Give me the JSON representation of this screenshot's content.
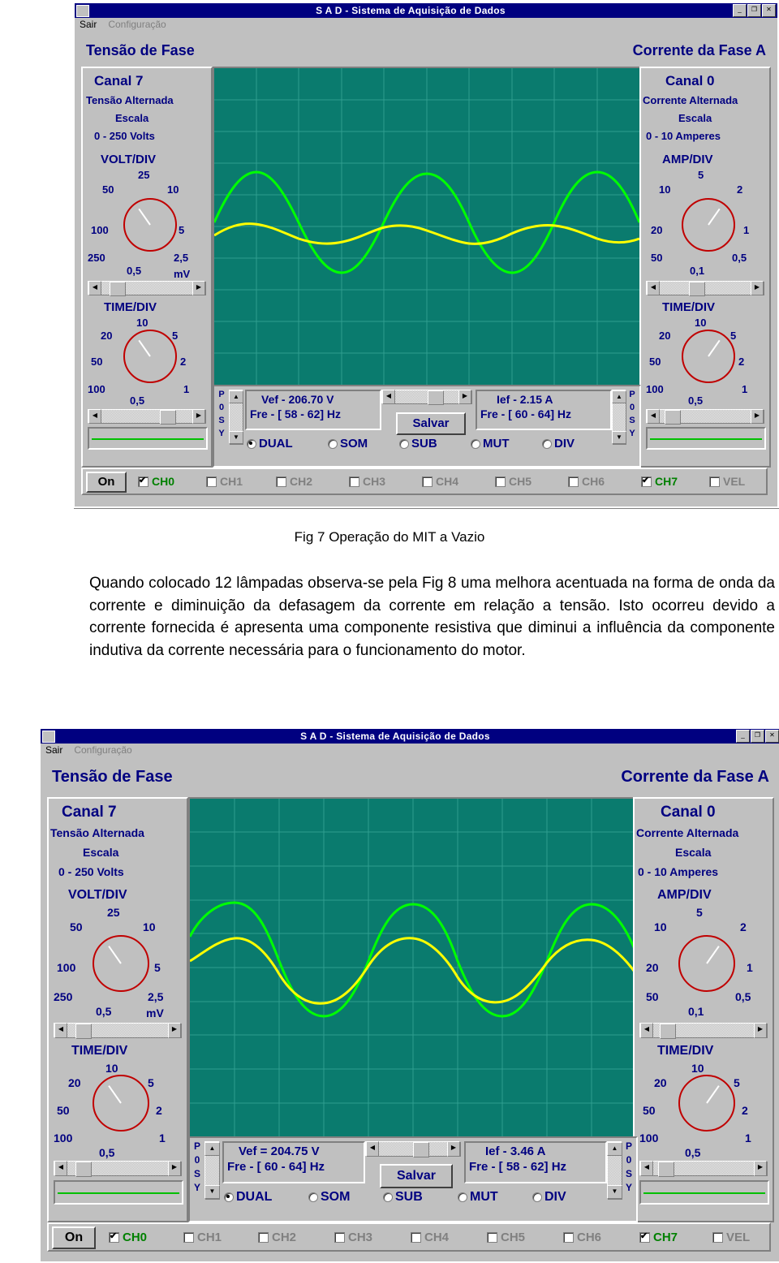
{
  "figure1": {
    "window": {
      "title": "S A D - Sistema de Aquisição de Dados",
      "minimize": "_",
      "maximize": "❐",
      "close": "✕",
      "menu": [
        "Sair",
        "Configuração"
      ]
    },
    "header_left": "Tensão de Fase",
    "header_right": "Corrente da Fase A",
    "left_panel": {
      "channel": "Canal 7",
      "type": "Tensão  Alternada",
      "scale_label": "Escala",
      "scale_range": "0 - 250 Volts",
      "knob1_title": "VOLT/DIV",
      "knob1_ticks": [
        "25",
        "50",
        "10",
        "100",
        "5",
        "250",
        "2,5",
        "0,5",
        "mV"
      ],
      "knob2_title": "TIME/DIV",
      "knob2_ticks": [
        "10",
        "20",
        "5",
        "50",
        "2",
        "100",
        "1",
        "0,5"
      ]
    },
    "right_panel": {
      "channel": "Canal 0",
      "type": "Corrente  Alternada",
      "scale_label": "Escala",
      "scale_range": "0 - 10 Amperes",
      "knob1_title": "AMP/DIV",
      "knob1_ticks": [
        "5",
        "10",
        "2",
        "20",
        "1",
        "50",
        "0,5",
        "0,1"
      ],
      "knob2_title": "TIME/DIV",
      "knob2_ticks": [
        "10",
        "20",
        "5",
        "50",
        "2",
        "100",
        "1",
        "0,5"
      ]
    },
    "readouts": {
      "psy_left": [
        "P",
        "0",
        "S",
        "Y"
      ],
      "psy_right": [
        "P",
        "0",
        "S",
        "Y"
      ],
      "vef": "Vef - 206.70 V",
      "freq_v": "Fre - [ 58 - 62] Hz",
      "ief": "Ief - 2.15 A",
      "freq_i": "Fre - [ 60 - 64] Hz",
      "save_button": "Salvar"
    },
    "modes": [
      {
        "label": "DUAL",
        "selected": true
      },
      {
        "label": "SOM",
        "selected": false
      },
      {
        "label": "SUB",
        "selected": false
      },
      {
        "label": "MUT",
        "selected": false
      },
      {
        "label": "DIV",
        "selected": false
      }
    ],
    "status": {
      "on_button": "On",
      "channels": [
        {
          "label": "CH0",
          "checked": true,
          "active": true
        },
        {
          "label": "CH1",
          "checked": false,
          "active": false
        },
        {
          "label": "CH2",
          "checked": false,
          "active": false
        },
        {
          "label": "CH3",
          "checked": false,
          "active": false
        },
        {
          "label": "CH4",
          "checked": false,
          "active": false
        },
        {
          "label": "CH5",
          "checked": false,
          "active": false
        },
        {
          "label": "CH6",
          "checked": false,
          "active": false
        },
        {
          "label": "CH7",
          "checked": true,
          "active": true
        },
        {
          "label": "VEL",
          "checked": false,
          "active": false
        }
      ]
    },
    "trace_colors": {
      "voltage": "#00ff00",
      "current": "#ffff00",
      "grid": "#2f9e8f",
      "background": "#0a7b6e"
    }
  },
  "caption": "Fig 7 Operação do MIT a Vazio",
  "body_text": "Quando colocado 12 lâmpadas observa-se pela Fig 8 uma melhora acentuada na forma de onda da corrente e diminuição da defasagem  da corrente em relação a tensão.  Isto ocorreu devido a corrente fornecida é apresenta uma componente resistiva que diminui a influência  da componente indutiva da corrente necessária para o funcionamento do motor.",
  "figure2": {
    "window": {
      "title": "S A D - Sistema de Aquisição de Dados",
      "minimize": "_",
      "maximize": "❐",
      "close": "✕",
      "menu": [
        "Sair",
        "Configuração"
      ]
    },
    "header_left": "Tensão de Fase",
    "header_right": "Corrente da Fase A",
    "left_panel": {
      "channel": "Canal 7",
      "type": "Tensão  Alternada",
      "scale_label": "Escala",
      "scale_range": "0 - 250 Volts",
      "knob1_title": "VOLT/DIV",
      "knob1_ticks": [
        "25",
        "50",
        "10",
        "100",
        "5",
        "250",
        "2,5",
        "0,5",
        "mV"
      ],
      "knob2_title": "TIME/DIV",
      "knob2_ticks": [
        "10",
        "20",
        "5",
        "50",
        "2",
        "100",
        "1",
        "0,5"
      ]
    },
    "right_panel": {
      "channel": "Canal 0",
      "type": "Corrente  Alternada",
      "scale_label": "Escala",
      "scale_range": "0 - 10 Amperes",
      "knob1_title": "AMP/DIV",
      "knob1_ticks": [
        "5",
        "10",
        "2",
        "20",
        "1",
        "50",
        "0,5",
        "0,1"
      ],
      "knob2_title": "TIME/DIV",
      "knob2_ticks": [
        "10",
        "20",
        "5",
        "50",
        "2",
        "100",
        "1",
        "0,5"
      ]
    },
    "readouts": {
      "psy_left": [
        "P",
        "0",
        "S",
        "Y"
      ],
      "psy_right": [
        "P",
        "0",
        "S",
        "Y"
      ],
      "vef": "Vef = 204.75 V",
      "freq_v": "Fre - [ 60 - 64] Hz",
      "ief": "Ief -  3.46 A",
      "freq_i": "Fre - [ 58 - 62] Hz",
      "save_button": "Salvar"
    },
    "modes": [
      {
        "label": "DUAL",
        "selected": true
      },
      {
        "label": "SOM",
        "selected": false
      },
      {
        "label": "SUB",
        "selected": false
      },
      {
        "label": "MUT",
        "selected": false
      },
      {
        "label": "DIV",
        "selected": false
      }
    ],
    "status": {
      "on_button": "On",
      "channels": [
        {
          "label": "CH0",
          "checked": true,
          "active": true
        },
        {
          "label": "CH1",
          "checked": false,
          "active": false
        },
        {
          "label": "CH2",
          "checked": false,
          "active": false
        },
        {
          "label": "CH3",
          "checked": false,
          "active": false
        },
        {
          "label": "CH4",
          "checked": false,
          "active": false
        },
        {
          "label": "CH5",
          "checked": false,
          "active": false
        },
        {
          "label": "CH6",
          "checked": false,
          "active": false
        },
        {
          "label": "CH7",
          "checked": true,
          "active": true
        },
        {
          "label": "VEL",
          "checked": false,
          "active": false
        }
      ]
    },
    "trace_colors": {
      "voltage": "#00ff00",
      "current": "#ffff00",
      "grid": "#2f9e8f",
      "background": "#0a7b6e"
    }
  }
}
